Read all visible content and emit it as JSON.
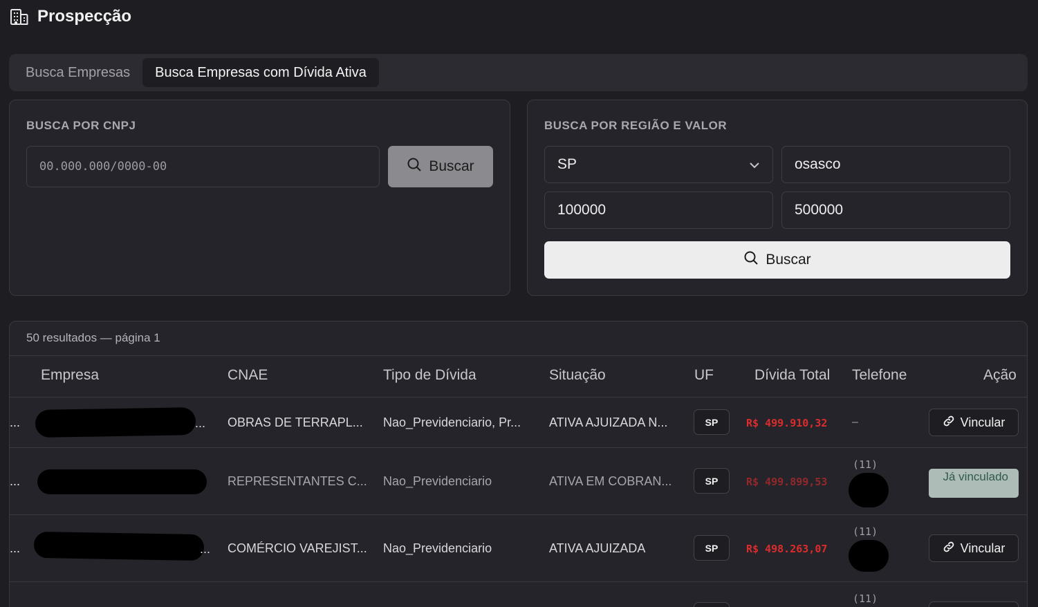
{
  "page": {
    "title": "Prospecção",
    "icon": "building-icon"
  },
  "tabs": [
    {
      "label": "Busca Empresas",
      "active": false
    },
    {
      "label": "Busca Empresas com Dívida Ativa",
      "active": true
    }
  ],
  "cnpj_search": {
    "title": "BUSCA POR CNPJ",
    "placeholder": "00.000.000/0000-00",
    "value": "",
    "button_label": "Buscar"
  },
  "region_search": {
    "title": "BUSCA POR REGIÃO E VALOR",
    "uf_selected": "SP",
    "city_value": "osasco",
    "min_value": "100000",
    "max_value": "500000",
    "button_label": "Buscar"
  },
  "results": {
    "summary": "50 resultados — página 1",
    "columns": [
      "Empresa",
      "CNAE",
      "Tipo de Dívida",
      "Situação",
      "UF",
      "Dívida Total",
      "Telefone",
      "Ação"
    ],
    "rows": [
      {
        "empresa_suffix": "...",
        "cnae": "OBRAS DE TERRAPL...",
        "tipo": "Nao_Previdenciario, Pr...",
        "situacao": "ATIVA AJUIZADA N...",
        "uf": "SP",
        "divida": "R$ 499.910,32",
        "telefone_ddd": "",
        "telefone_empty": "–",
        "acao": "Vincular",
        "vinculado": false
      },
      {
        "empresa_suffix": "",
        "cnae": "REPRESENTANTES C...",
        "tipo": "Nao_Previdenciario",
        "situacao": "ATIVA EM COBRAN...",
        "uf": "SP",
        "divida": "R$ 499.899,53",
        "telefone_ddd": "(11)",
        "telefone_empty": "",
        "acao": "Já vinculado",
        "vinculado": true
      },
      {
        "empresa_suffix": "...",
        "cnae": "COMÉRCIO VAREJIST...",
        "tipo": "Nao_Previdenciario",
        "situacao": "ATIVA AJUIZADA",
        "uf": "SP",
        "divida": "R$ 498.263,07",
        "telefone_ddd": "(11)",
        "telefone_empty": "",
        "acao": "Vincular",
        "vinculado": false
      },
      {
        "telefone_ddd": "(11)"
      }
    ]
  },
  "colors": {
    "background": "#1e1d21",
    "card": "#25242a",
    "debt_red": "#dc2c2c",
    "linked_badge": "#aebcb7"
  }
}
